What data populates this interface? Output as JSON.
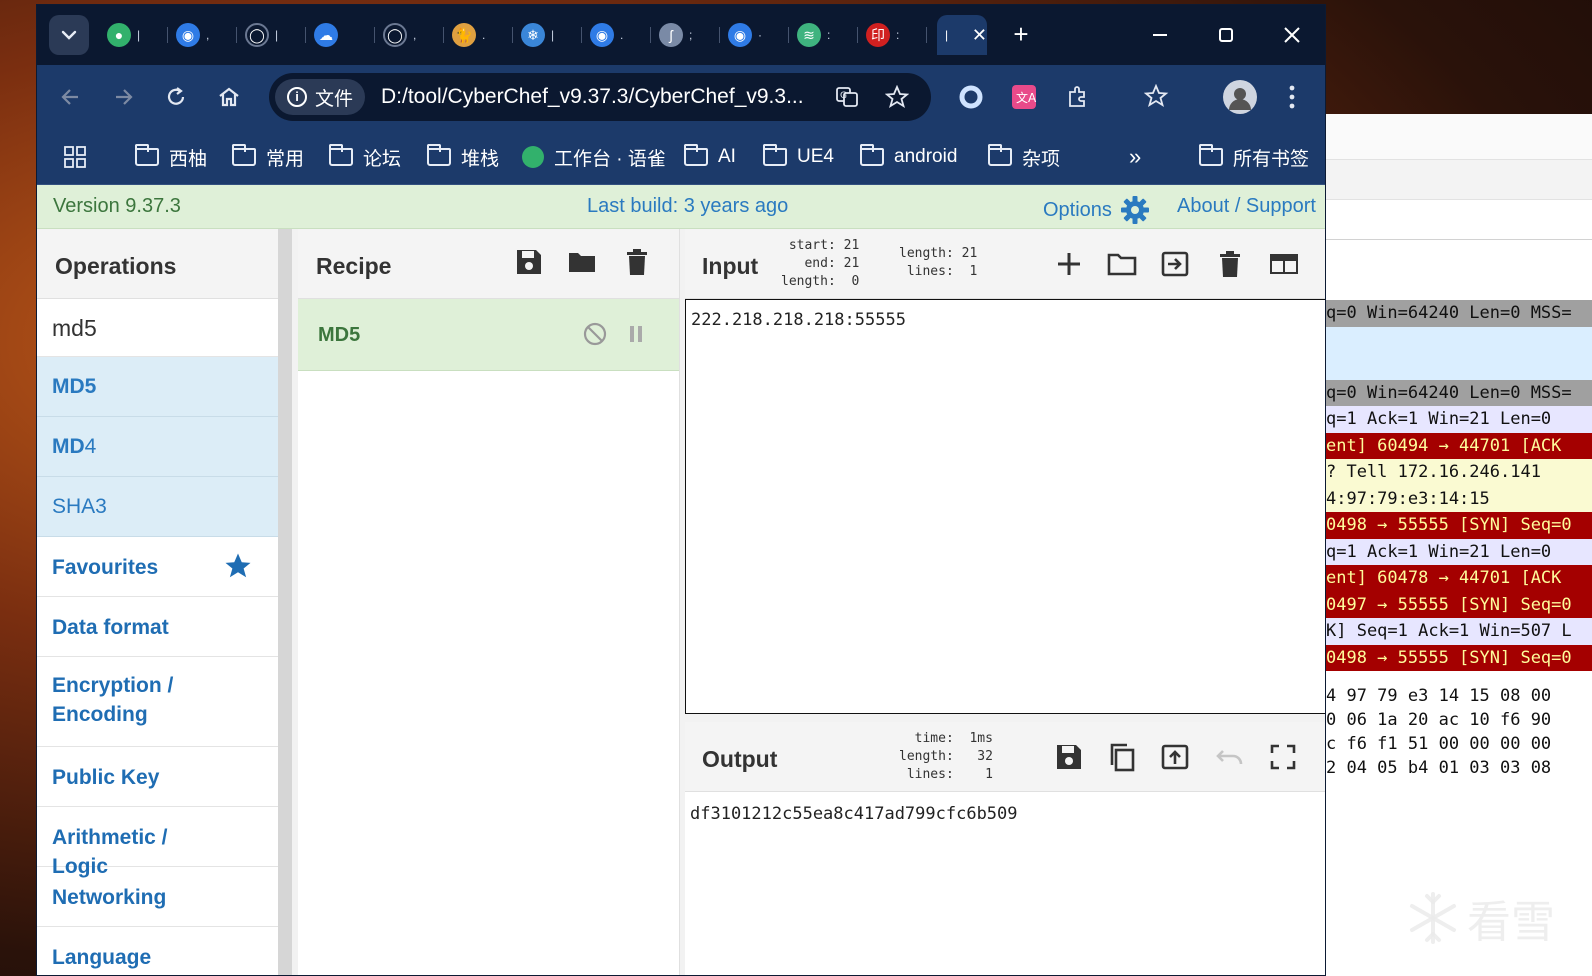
{
  "browser": {
    "tabs": [
      {
        "icon": "yuque-leaf-icon",
        "color": "#32b16c",
        "title": "|"
      },
      {
        "icon": "fingerprint-icon",
        "color": "#2f7be6",
        "title": ","
      },
      {
        "icon": "github-icon",
        "color": "#0b1830",
        "title": "|"
      },
      {
        "icon": "cloud-icon",
        "color": "#2f7be6",
        "title": ""
      },
      {
        "icon": "github-icon",
        "color": "#0b1830",
        "title": ","
      },
      {
        "icon": "cat-icon",
        "color": "#e0a040",
        "title": "."
      },
      {
        "icon": "snowflake-icon",
        "color": "#3a86d8",
        "title": "|"
      },
      {
        "icon": "fingerprint-icon",
        "color": "#2f7be6",
        "title": "."
      },
      {
        "icon": "script-icon",
        "color": "#7a8aa6",
        "title": ";"
      },
      {
        "icon": "fingerprint-icon",
        "color": "#2f7be6",
        "title": "·"
      },
      {
        "icon": "leaf-list-icon",
        "color": "#3fb37f",
        "title": ":"
      },
      {
        "icon": "seal-icon",
        "color": "#d02020",
        "title": ":"
      }
    ],
    "active_tab_label": "|",
    "new_tab": "+",
    "site_chip": "文件",
    "url": "D:/tool/CyberChef_v9.37.3/CyberChef_v9.3...",
    "bookmarks": [
      {
        "label": "西柚",
        "type": "folder"
      },
      {
        "label": "常用",
        "type": "folder"
      },
      {
        "label": "论坛",
        "type": "folder"
      },
      {
        "label": "堆栈",
        "type": "folder"
      },
      {
        "label": "工作台 · 语雀",
        "type": "site"
      },
      {
        "label": "AI",
        "type": "folder"
      },
      {
        "label": "UE4",
        "type": "folder"
      },
      {
        "label": "android",
        "type": "folder"
      },
      {
        "label": "杂项",
        "type": "folder"
      }
    ],
    "more": "»",
    "all_bookmarks": "所有书签"
  },
  "cyberchef": {
    "version": "Version 9.37.3",
    "last_build": "Last build: 3 years ago",
    "options": "Options",
    "about": "About / Support",
    "operations_title": "Operations",
    "search_value": "md5",
    "search_results": [
      {
        "bold": "MD5",
        "rest": ""
      },
      {
        "bold": "MD",
        "rest": "4"
      },
      {
        "bold": "",
        "rest": "SHA3"
      }
    ],
    "categories": [
      "Favourites",
      "Data format",
      "Encryption / Encoding",
      "Public Key",
      "Arithmetic / Logic",
      "Networking",
      "Language"
    ],
    "recipe_title": "Recipe",
    "recipe_op": "MD5",
    "input_title": "Input",
    "input_stats_left": "start: 21\n  end: 21\nlength:  0",
    "input_stats_right": "length: 21\n lines:  1",
    "input_text": "222.218.218.218:55555",
    "output_title": "Output",
    "output_stats": "  time:  1ms\nlength:   32\n lines:    1",
    "output_text": "df3101212c55ea8c417ad799cfc6b509"
  },
  "background_window": {
    "packets": [
      {
        "text": "q=0 Win=64240 Len=0 MSS=",
        "bg": "#a0a0a0",
        "fg": "#111111"
      },
      {
        "text": "",
        "bg": "#daeeff",
        "fg": "#111111"
      },
      {
        "text": "",
        "bg": "#daeeff",
        "fg": "#111111"
      },
      {
        "text": "q=0 Win=64240 Len=0 MSS=",
        "bg": "#a0a0a0",
        "fg": "#111111"
      },
      {
        "text": "q=1 Ack=1 Win=21 Len=0",
        "bg": "#e7e6ff",
        "fg": "#111111"
      },
      {
        "text": "ent] 60494 → 44701 [ACK",
        "bg": "#a40000",
        "fg": "#fffc9c"
      },
      {
        "text": "? Tell 172.16.246.141",
        "bg": "#fafad2",
        "fg": "#111111"
      },
      {
        "text": "4:97:79:e3:14:15",
        "bg": "#fafad2",
        "fg": "#111111"
      },
      {
        "text": "0498 → 55555 [SYN] Seq=0",
        "bg": "#a40000",
        "fg": "#fffc9c"
      },
      {
        "text": "q=1 Ack=1 Win=21 Len=0",
        "bg": "#e7e6ff",
        "fg": "#111111"
      },
      {
        "text": "ent] 60478 → 44701 [ACK",
        "bg": "#a40000",
        "fg": "#fffc9c"
      },
      {
        "text": "0497 → 55555 [SYN] Seq=0",
        "bg": "#a40000",
        "fg": "#fffc9c"
      },
      {
        "text": "K] Seq=1 Ack=1 Win=507 L",
        "bg": "#e7e6ff",
        "fg": "#111111"
      },
      {
        "text": "0498 → 55555 [SYN] Seq=0",
        "bg": "#a40000",
        "fg": "#fffc9c"
      }
    ],
    "hex_rows": [
      "4 97  79 e3 14 15 08 00",
      "0 06  1a 20 ac 10 f6 90",
      "c f6  f1 51 00 00 00 00",
      "2 04  05 b4 01 03 03 08"
    ],
    "watermark": "看雪"
  }
}
